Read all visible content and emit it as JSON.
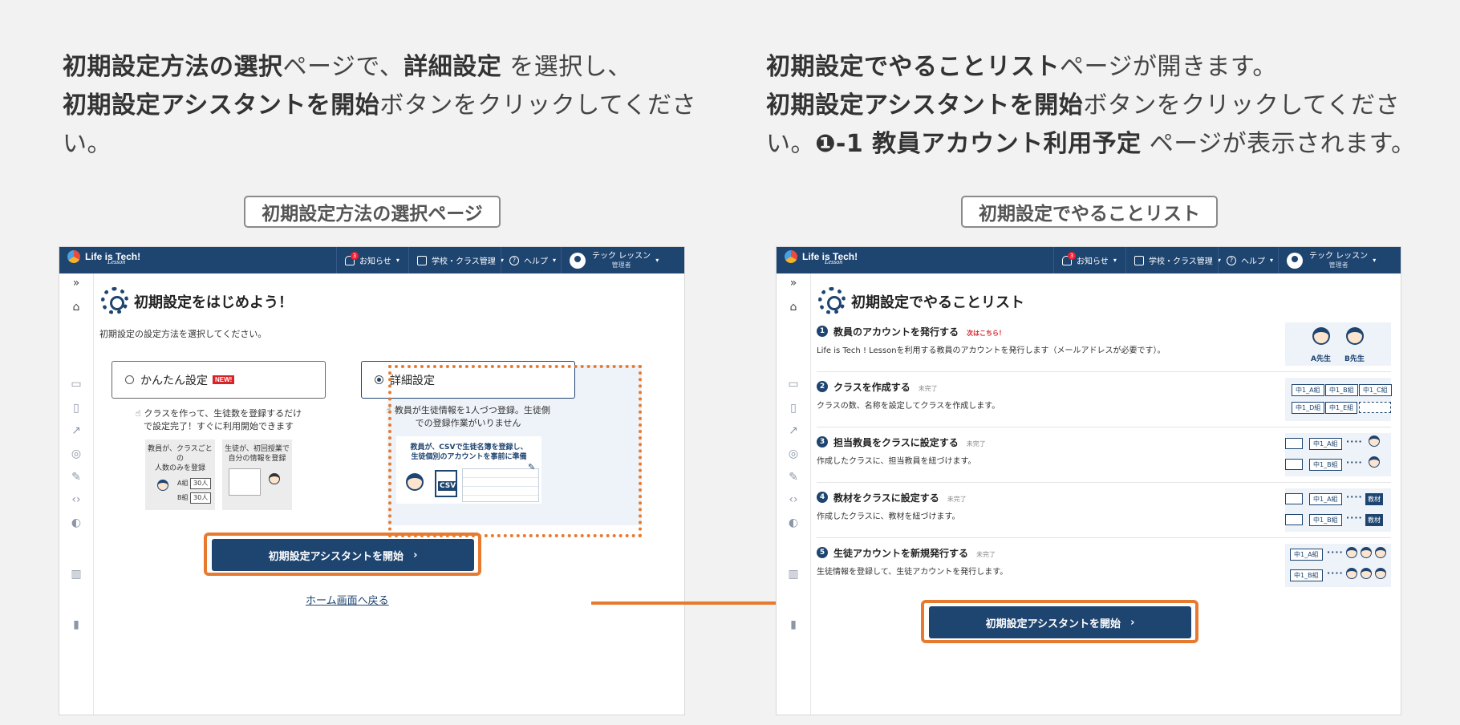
{
  "intro_left": {
    "b1": "初期設定方法の選択",
    "t1": "ページで、",
    "b2": "詳細設定",
    "t2": " を選択し、",
    "b3": "初期設定アシスタントを開始",
    "t3": "ボタンをクリックしてください。"
  },
  "intro_right": {
    "b1": "初期設定でやることリスト",
    "t1": "ページが開きます。",
    "b2": "初期設定アシスタントを開始",
    "t2": "ボタンをクリックしてください。",
    "b3": "❶-1 教員アカウント利用予定",
    "t3": " ページが表示されます。"
  },
  "captions": {
    "left": "初期設定方法の選択ページ",
    "right": "初期設定でやることリスト"
  },
  "app": {
    "logo": "Life is Tech!",
    "logo_sub": "Lesson",
    "notifications": "お知らせ",
    "notification_count": "3",
    "school_class": "学校・クラス管理",
    "help": "ヘルプ",
    "user_name": "テック レッスン",
    "user_role": "管理者"
  },
  "left_page": {
    "title": "初期設定をはじめよう！",
    "instruction": "初期設定の設定方法を選択してください。",
    "easy": {
      "label": "かんたん設定",
      "badge": "NEW!",
      "desc1": "クラスを作って、生徒数を登録するだけ",
      "desc2": "で設定完了！すぐに利用開始できます",
      "card1_l1": "教員が、クラスごと",
      "card1_l2": "の",
      "card1_l3": "人数のみを登録",
      "card1_a": "A組",
      "card1_a_n": "30人",
      "card1_b": "B組",
      "card1_b_n": "30人",
      "card2_l1": "生徒が、初回授業で",
      "card2_l2": "自分の情報を登録"
    },
    "detail": {
      "label": "詳細設定",
      "desc1": "教員が生徒情報を1人づつ登録。生徒側",
      "desc2": "での登録作業がいりません",
      "card_l1": "教員が、CSVで生徒名簿を登録し、",
      "card_l2": "生徒個別のアカウントを事前に準備",
      "csv": "CSV"
    },
    "start_button": "初期設定アシスタントを開始",
    "home_link": "ホーム画面へ戻る"
  },
  "right_page": {
    "title": "初期設定でやることリスト",
    "steps": [
      {
        "num": "1",
        "title": "教員のアカウントを発行する",
        "status": "次はこちら！",
        "desc": "Life is Tech ! Lessonを利用する教員のアカウントを発行します（メールアドレスが必要です）。"
      },
      {
        "num": "2",
        "title": "クラスを作成する",
        "status": "未完了",
        "desc": "クラスの数、名称を設定してクラスを作成します。"
      },
      {
        "num": "3",
        "title": "担当教員をクラスに設定する",
        "status": "未完了",
        "desc": "作成したクラスに、担当教員を紐づけます。"
      },
      {
        "num": "4",
        "title": "教材をクラスに設定する",
        "status": "未完了",
        "desc": "作成したクラスに、教材を紐づけます。"
      },
      {
        "num": "5",
        "title": "生徒アカウントを新規発行する",
        "status": "未完了",
        "desc": "生徒情報を登録して、生徒アカウントを発行します。"
      }
    ],
    "teacher_a": "A先生",
    "teacher_b": "B先生",
    "classes": [
      "中1_A組",
      "中1_B組",
      "中1_C組",
      "中1_D組",
      "中1_E組"
    ],
    "material": "教材",
    "start_button": "初期設定アシスタントを開始"
  },
  "colors": {
    "brand": "#1e4470",
    "highlight": "#e87a2f",
    "new_badge": "#d72226"
  }
}
